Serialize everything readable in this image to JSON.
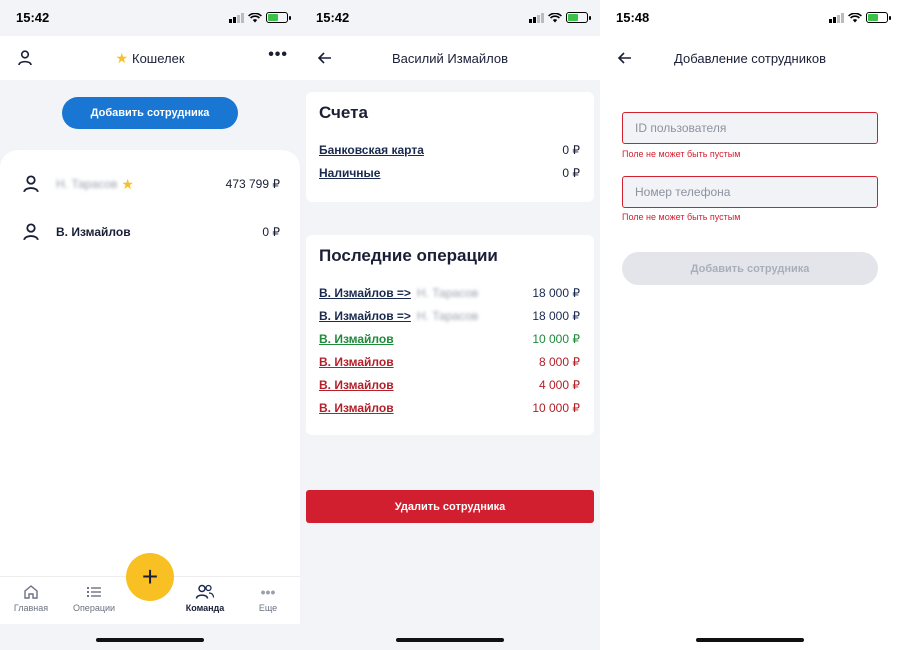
{
  "screens": [
    {
      "time": "15:42",
      "title": "Кошелек",
      "add_button": "Добавить сотрудника",
      "employees": [
        {
          "name": "Н. Тарасов",
          "balance": "473 799 ₽",
          "starred": true
        },
        {
          "name": "В. Измайлов",
          "balance": "0 ₽",
          "starred": false
        }
      ],
      "tabs": [
        {
          "label": "Главная",
          "icon": "home-icon"
        },
        {
          "label": "Операции",
          "icon": "list-icon"
        },
        {
          "label": "Команда",
          "icon": "team-icon"
        },
        {
          "label": "Еще",
          "icon": "more-icon"
        }
      ],
      "fab": "+"
    },
    {
      "time": "15:42",
      "title": "Василий Измайлов",
      "accounts_title": "Счета",
      "accounts": [
        {
          "label": "Банковская карта",
          "amount": "0 ₽"
        },
        {
          "label": "Наличные",
          "amount": "0 ₽"
        }
      ],
      "ops_title": "Последние операции",
      "operations": [
        {
          "label": "В. Измайлов =>",
          "target": "Н. Тарасов",
          "amount": "18 000 ₽",
          "color": "#1a2a4f"
        },
        {
          "label": "В. Измайлов =>",
          "target": "Н. Тарасов",
          "amount": "18 000 ₽",
          "color": "#1a2a4f"
        },
        {
          "label": "В. Измайлов",
          "target": "",
          "amount": "10 000 ₽",
          "color": "#1e8a3a"
        },
        {
          "label": "В. Измайлов",
          "target": "",
          "amount": "8 000 ₽",
          "color": "#b3202a"
        },
        {
          "label": "В. Измайлов",
          "target": "",
          "amount": "4 000 ₽",
          "color": "#b3202a"
        },
        {
          "label": "В. Измайлов",
          "target": "",
          "amount": "10 000 ₽",
          "color": "#b3202a"
        }
      ],
      "delete_button": "Удалить сотрудника"
    },
    {
      "time": "15:48",
      "title": "Добавление сотрудников",
      "user_id": {
        "placeholder": "ID пользователя",
        "error": "Поле не может быть пустым"
      },
      "phone": {
        "placeholder": "Номер телефона",
        "error": "Поле не может быть пустым"
      },
      "submit_button": "Добавить сотрудника"
    }
  ]
}
